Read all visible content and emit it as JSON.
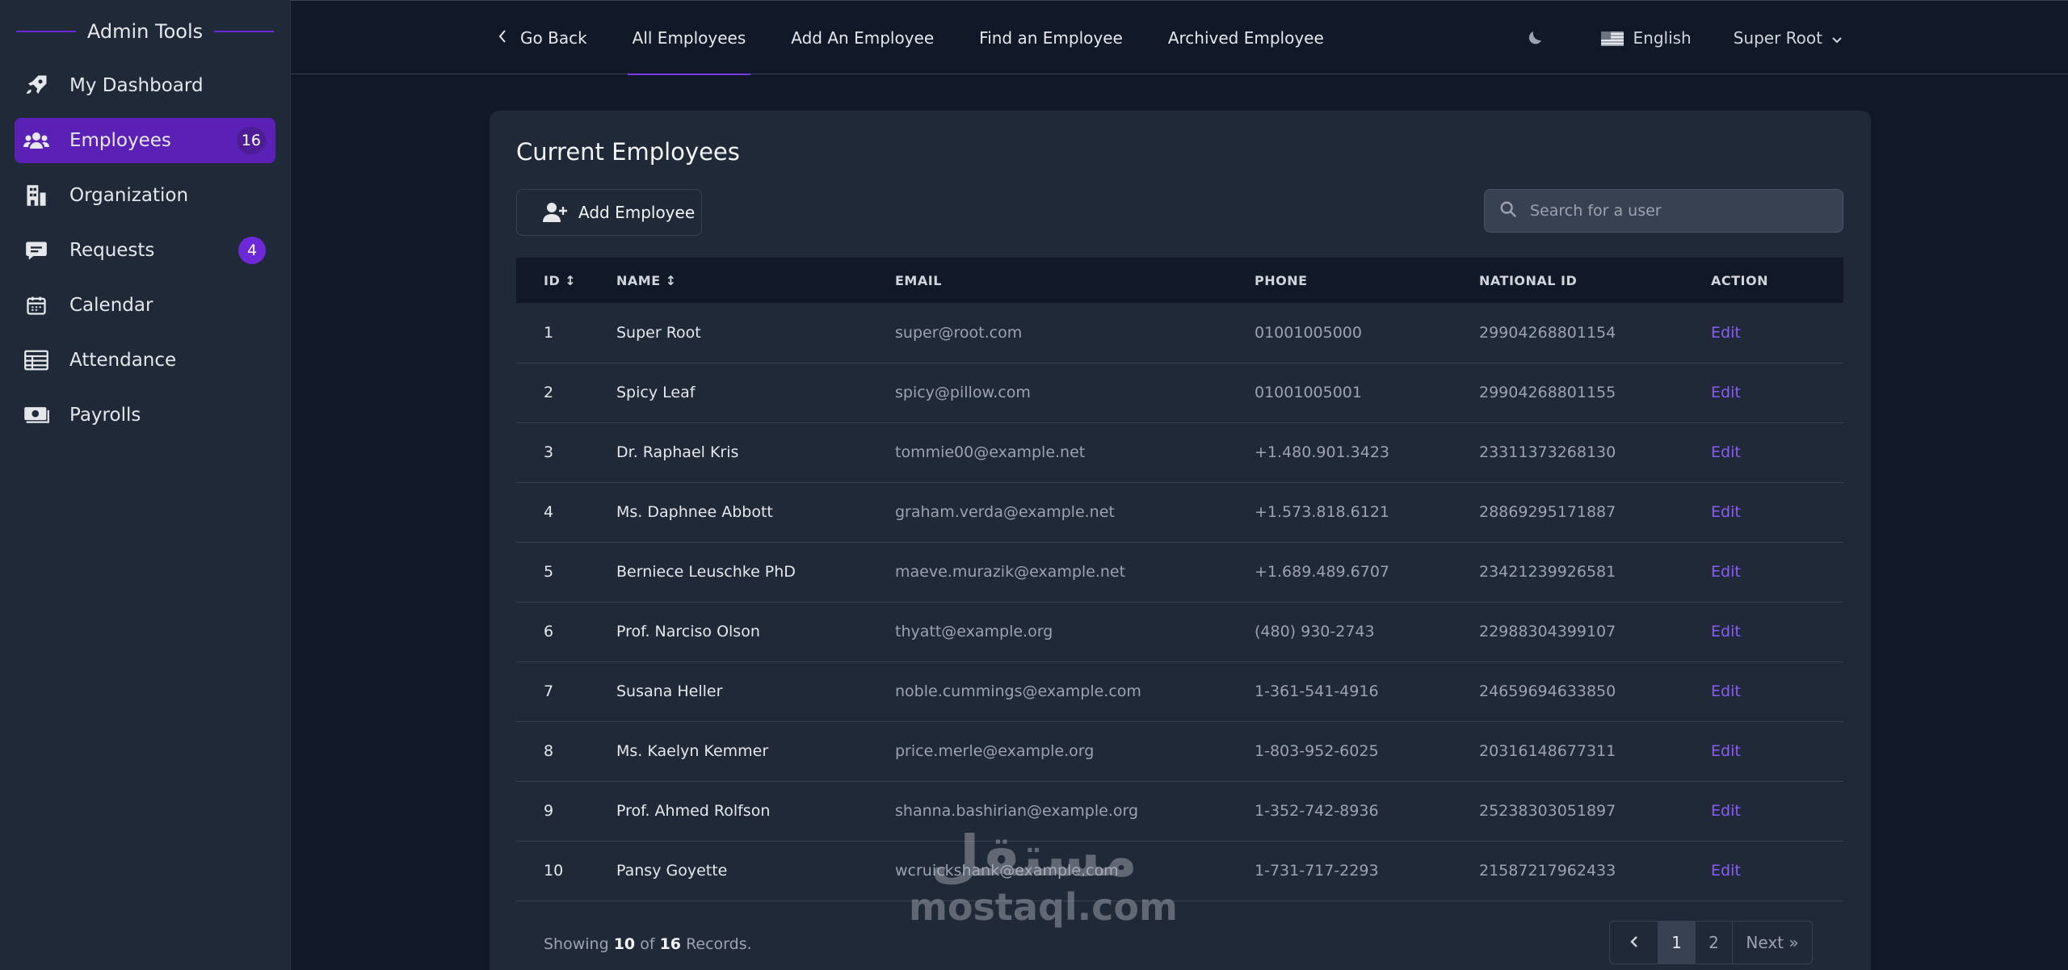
{
  "sidebar": {
    "title": "Admin Tools",
    "items": [
      {
        "label": "My Dashboard",
        "icon": "rocket-icon"
      },
      {
        "label": "Employees",
        "icon": "users-icon",
        "badge": "16",
        "active": true
      },
      {
        "label": "Organization",
        "icon": "building-icon"
      },
      {
        "label": "Requests",
        "icon": "message-icon",
        "badge": "4"
      },
      {
        "label": "Calendar",
        "icon": "calendar-icon"
      },
      {
        "label": "Attendance",
        "icon": "table-icon"
      },
      {
        "label": "Payrolls",
        "icon": "money-icon"
      }
    ]
  },
  "topbar": {
    "tabs": [
      "Go Back",
      "All Employees",
      "Add An Employee",
      "Find an Employee",
      "Archived Employee"
    ],
    "active_tab": "All Employees",
    "language": "English",
    "user": "Super Root"
  },
  "main": {
    "title": "Current Employees",
    "add_button": "Add Employee",
    "search_placeholder": "Search for a user",
    "columns": [
      "ID ↕",
      "NAME ↕",
      "EMAIL",
      "PHONE",
      "NATIONAL ID",
      "ACTION"
    ],
    "rows": [
      {
        "id": "1",
        "name": "Super Root",
        "email": "super@root.com",
        "phone": "01001005000",
        "national_id": "29904268801154",
        "action": "Edit"
      },
      {
        "id": "2",
        "name": "Spicy Leaf",
        "email": "spicy@pillow.com",
        "phone": "01001005001",
        "national_id": "29904268801155",
        "action": "Edit"
      },
      {
        "id": "3",
        "name": "Dr. Raphael Kris",
        "email": "tommie00@example.net",
        "phone": "+1.480.901.3423",
        "national_id": "23311373268130",
        "action": "Edit"
      },
      {
        "id": "4",
        "name": "Ms. Daphnee Abbott",
        "email": "graham.verda@example.net",
        "phone": "+1.573.818.6121",
        "national_id": "28869295171887",
        "action": "Edit"
      },
      {
        "id": "5",
        "name": "Berniece Leuschke PhD",
        "email": "maeve.murazik@example.net",
        "phone": "+1.689.489.6707",
        "national_id": "23421239926581",
        "action": "Edit"
      },
      {
        "id": "6",
        "name": "Prof. Narciso Olson",
        "email": "thyatt@example.org",
        "phone": "(480) 930-2743",
        "national_id": "22988304399107",
        "action": "Edit"
      },
      {
        "id": "7",
        "name": "Susana Heller",
        "email": "noble.cummings@example.com",
        "phone": "1-361-541-4916",
        "national_id": "24659694633850",
        "action": "Edit"
      },
      {
        "id": "8",
        "name": "Ms. Kaelyn Kemmer",
        "email": "price.merle@example.org",
        "phone": "1-803-952-6025",
        "national_id": "20316148677311",
        "action": "Edit"
      },
      {
        "id": "9",
        "name": "Prof. Ahmed Rolfson",
        "email": "shanna.bashirian@example.org",
        "phone": "1-352-742-8936",
        "national_id": "25238303051897",
        "action": "Edit"
      },
      {
        "id": "10",
        "name": "Pansy Goyette",
        "email": "wcruickshank@example.com",
        "phone": "1-731-717-2293",
        "national_id": "21587217962433",
        "action": "Edit"
      }
    ],
    "footer": {
      "prefix": "Showing",
      "shown": "10",
      "of": "of",
      "total": "16",
      "suffix": "Records."
    },
    "pagination": {
      "pages": [
        "1",
        "2"
      ],
      "active": "1",
      "next": "Next »"
    }
  },
  "watermark": {
    "arabic": "مستقل",
    "latin": "mostaql.com"
  },
  "colors": {
    "accent": "#7c3aed",
    "active_nav": "#5b21b6",
    "background": "#111827",
    "panel": "#1f2937"
  }
}
